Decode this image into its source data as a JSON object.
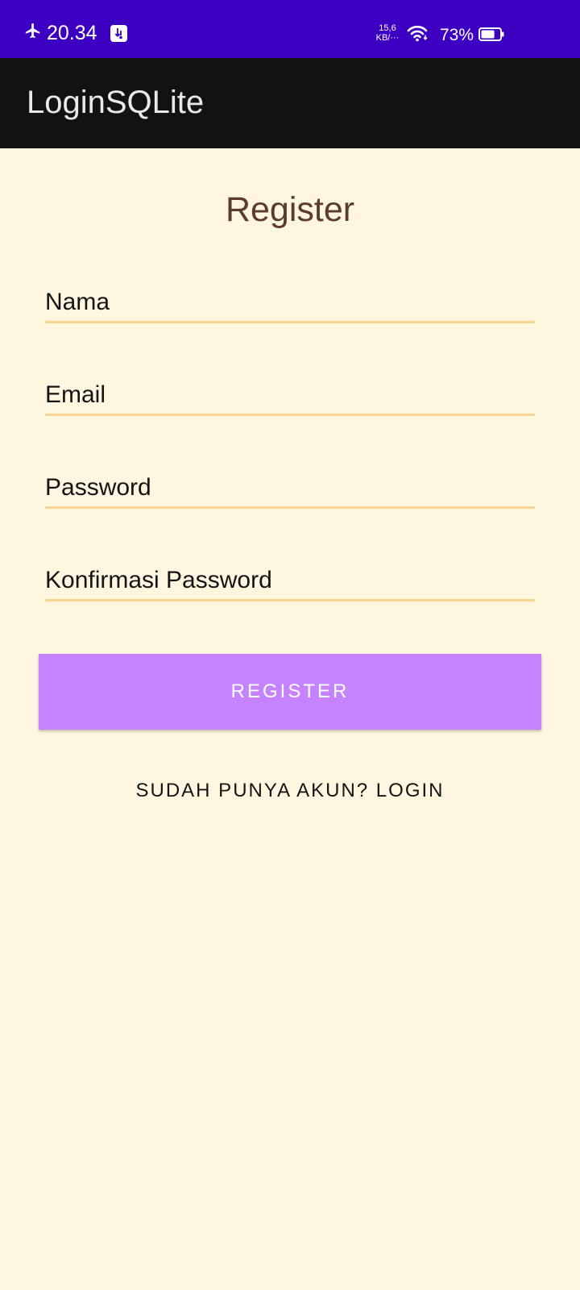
{
  "status_bar": {
    "time": "20.34",
    "net_speed_value": "15,6",
    "net_speed_unit": "KB/···",
    "battery_percent": "73%",
    "battery_level": 0.73,
    "icons": [
      "airplane-icon",
      "usb-debug-icon",
      "wifi-icon",
      "battery-icon"
    ],
    "background_color": "#3d00c2"
  },
  "app_bar": {
    "title": "LoginSQLite",
    "background_color": "#121212"
  },
  "form": {
    "heading": "Register",
    "fields": [
      {
        "label": "Nama",
        "value": ""
      },
      {
        "label": "Email",
        "value": ""
      },
      {
        "label": "Password",
        "value": ""
      },
      {
        "label": "Konfirmasi Password",
        "value": ""
      }
    ],
    "underline_color": "#f9d48f"
  },
  "actions": {
    "register_label": "REGISTER",
    "register_color": "#c583ff",
    "login_link_label": "SUDAH PUNYA AKUN? LOGIN"
  },
  "theme": {
    "page_background": "#fff6df",
    "heading_color": "#5b3b2e"
  }
}
